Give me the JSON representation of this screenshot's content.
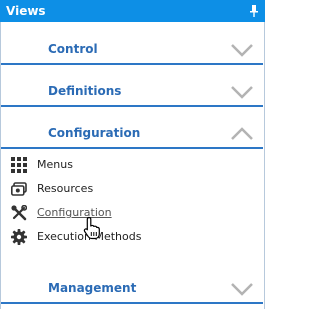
{
  "panel": {
    "title": "Views",
    "pin_icon": "pin-icon"
  },
  "sections": [
    {
      "label": "Control",
      "state": "collapsed",
      "chevron_icon": "chevron-down-icon"
    },
    {
      "label": "Definitions",
      "state": "collapsed",
      "chevron_icon": "chevron-down-icon"
    },
    {
      "label": "Configuration",
      "state": "expanded",
      "chevron_icon": "chevron-up-icon"
    },
    {
      "label": "Management",
      "state": "collapsed",
      "chevron_icon": "chevron-down-icon"
    }
  ],
  "configuration_items": [
    {
      "label": "Menus",
      "icon": "grid-icon"
    },
    {
      "label": "Resources",
      "icon": "resources-icon"
    },
    {
      "label": "Configuration",
      "icon": "tools-icon",
      "hovered": true
    },
    {
      "label": "Execution Methods",
      "icon": "gear-icon"
    }
  ],
  "colors": {
    "title_bar": "#0d8fe6",
    "section_label": "#2b6bb5",
    "divider": "#2d77c6",
    "frame": "#b7c9dc",
    "chevron": "#b3b3b3",
    "icon": "#333333"
  },
  "cursor": "hand-pointer-icon"
}
